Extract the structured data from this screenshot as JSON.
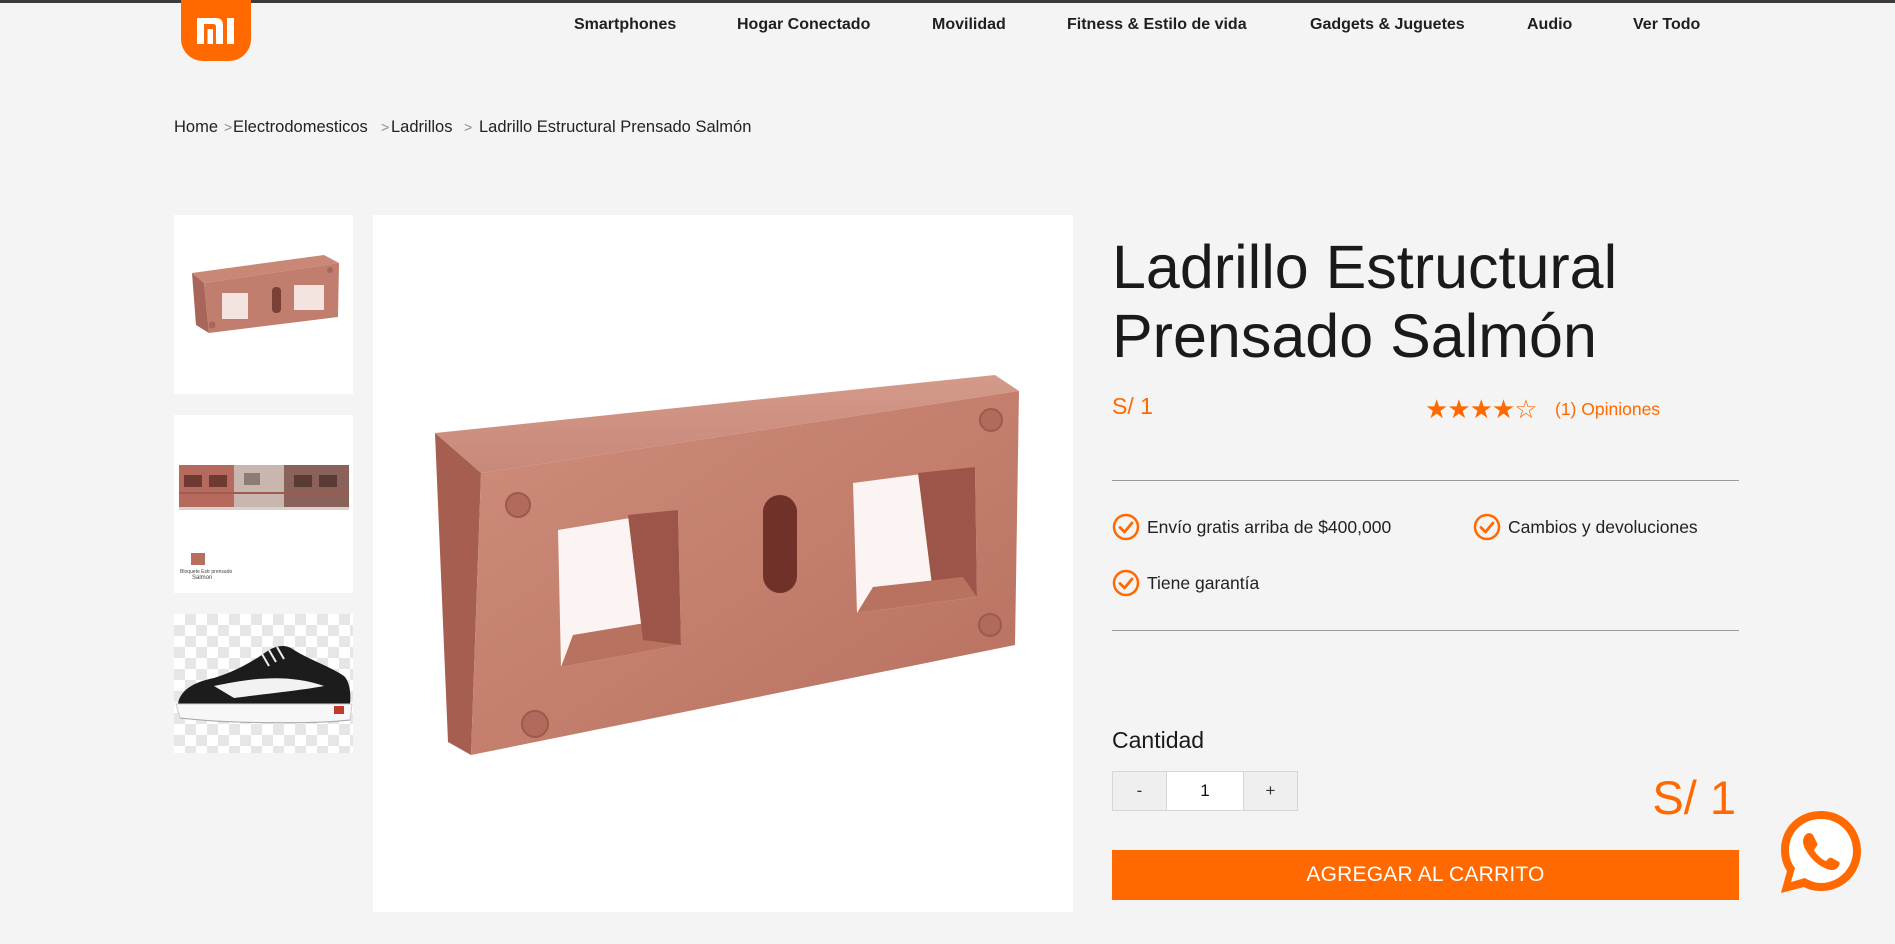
{
  "header": {
    "logo_text": "MI",
    "nav": [
      {
        "label": "Smartphones"
      },
      {
        "label": "Hogar Conectado"
      },
      {
        "label": "Movilidad"
      },
      {
        "label": "Fitness & Estilo de vida"
      },
      {
        "label": "Gadgets & Juguetes"
      },
      {
        "label": "Audio"
      },
      {
        "label": "Ver Todo"
      }
    ]
  },
  "breadcrumb": {
    "items": [
      "Home",
      "Electrodomesticos",
      "Ladrillos",
      "Ladrillo Estructural Prensado Salmón"
    ],
    "separator": ">"
  },
  "gallery": {
    "thumbnails": [
      {
        "icon": "brick-thumbnail"
      },
      {
        "icon": "brick-stack-thumbnail",
        "caption_line1": "Bloquete Estr prensado",
        "caption_line2": "Salmon"
      },
      {
        "icon": "sneaker-thumbnail"
      }
    ],
    "main_image": "brick-image"
  },
  "product": {
    "title_line1": "Ladrillo Estructural",
    "title_line2": "Prensado Salmón",
    "price": "S/ 1",
    "rating": {
      "value": 4,
      "max": 5,
      "stars_text": "★★★★☆",
      "reviews_label": "(1) Opiniones"
    },
    "features": [
      {
        "label": "Envío gratis arriba de $400,000"
      },
      {
        "label": "Cambios y devoluciones"
      },
      {
        "label": "Tiene garantía"
      }
    ],
    "quantity": {
      "label": "Cantidad",
      "value": "1",
      "decrement": "-",
      "increment": "+"
    },
    "total_price": "S/ 1",
    "add_to_cart_label": "AGREGAR AL CARRITO"
  },
  "colors": {
    "accent": "#ff6900",
    "background": "#f4f4f4",
    "whatsapp_icon": "#ff6900"
  }
}
